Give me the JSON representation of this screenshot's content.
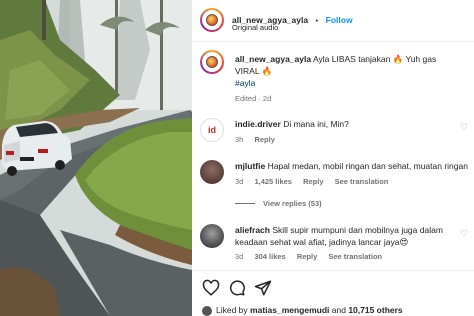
{
  "post": {
    "username": "all_new_agya_ayla",
    "dot": "•",
    "follow_label": "Follow",
    "audio": "Original audio"
  },
  "caption": {
    "username": "all_new_agya_ayla",
    "text": "Ayla LIBAS tanjakan 🔥 Yuh gas VIRAL 🔥",
    "hashtag": "#ayla",
    "edited": "Edited · 2d"
  },
  "comments": [
    {
      "username": "indie.driver",
      "text": "Di mana ini, Min?",
      "time": "3h",
      "reply": "Reply"
    },
    {
      "username": "mjlutfie",
      "text": "Hapal medan, mobil ringan dan sehat, muatan ringan",
      "time": "3d",
      "likes": "1,425 likes",
      "reply": "Reply",
      "translation": "See translation",
      "view_replies": "View replies (53)"
    },
    {
      "username": "aliefrach",
      "text": "Skill supir mumpuni dan mobilnya juga dalam keadaan sehat wal afiat, jadinya lancar jaya😍",
      "time": "3d",
      "likes": "304 likes",
      "reply": "Reply",
      "translation": "See translation"
    }
  ],
  "likes_line": {
    "prefix": "Liked by ",
    "user": "matias_mengemudi",
    "middle": " and ",
    "count": "10,715 others"
  },
  "colors": {
    "follow_blue": "#0095f6",
    "hashtag_blue": "#00376b",
    "meta_gray": "#737373"
  },
  "icons": [
    "heart-icon",
    "comment-icon",
    "share-icon",
    "heart-outline-icon"
  ]
}
